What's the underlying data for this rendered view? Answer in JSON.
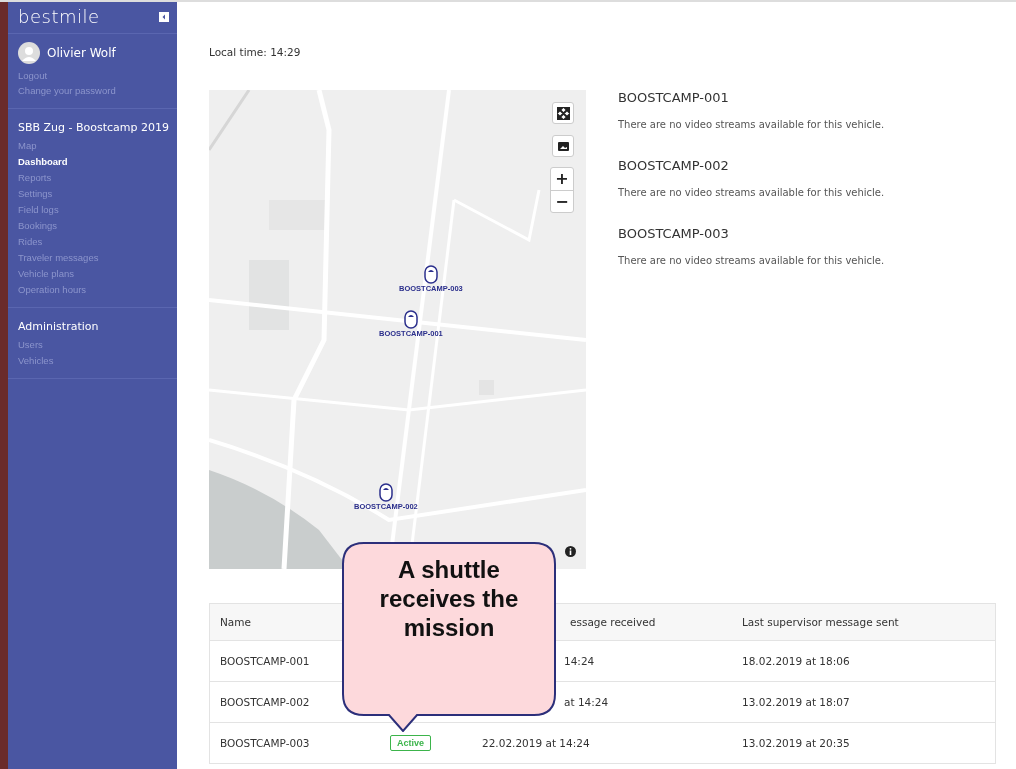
{
  "sidebar": {
    "logo": "bestmile",
    "user": {
      "name": "Olivier Wolf"
    },
    "account_links": [
      "Logout",
      "Change your password"
    ],
    "sections": [
      {
        "title": "SBB Zug - Boostcamp 2019",
        "items": [
          {
            "label": "Map",
            "selected": false
          },
          {
            "label": "Dashboard",
            "selected": true
          },
          {
            "label": "Reports",
            "selected": false
          },
          {
            "label": "Settings",
            "selected": false
          },
          {
            "label": "Field logs",
            "selected": false
          },
          {
            "label": "Bookings",
            "selected": false
          },
          {
            "label": "Rides",
            "selected": false
          },
          {
            "label": "Traveler messages",
            "selected": false
          },
          {
            "label": "Vehicle plans",
            "selected": false
          },
          {
            "label": "Operation hours",
            "selected": false
          }
        ]
      },
      {
        "title": "Administration",
        "items": [
          {
            "label": "Users",
            "selected": false
          },
          {
            "label": "Vehicles",
            "selected": false
          }
        ]
      }
    ]
  },
  "local_time": "Local time: 14:29",
  "map": {
    "kind": "picture",
    "zoom_in": "+",
    "zoom_out": "−",
    "markers": [
      {
        "label": "BOOSTCAMP-003"
      },
      {
        "label": "BOOSTCAMP-001"
      },
      {
        "label": "BOOSTCAMP-002"
      }
    ]
  },
  "streams": [
    {
      "vehicle": "BOOSTCAMP-001",
      "message": "There are no video streams available for this vehicle."
    },
    {
      "vehicle": "BOOSTCAMP-002",
      "message": "There are no video streams available for this vehicle."
    },
    {
      "vehicle": "BOOSTCAMP-003",
      "message": "There are no video streams available for this vehicle."
    }
  ],
  "table": {
    "columns": [
      "Name",
      "",
      "essage received",
      "Last supervisor message sent"
    ],
    "rows": [
      {
        "name": "BOOSTCAMP-001",
        "status": "",
        "received": "14:24",
        "sent": "18.02.2019 at 18:06"
      },
      {
        "name": "BOOSTCAMP-002",
        "status": "",
        "received": "at 14:24",
        "sent": "13.02.2019 at 18:07"
      },
      {
        "name": "BOOSTCAMP-003",
        "status": "Active",
        "received": "22.02.2019 at 14:24",
        "sent": "13.02.2019 at 20:35"
      }
    ]
  },
  "callout": {
    "text": "A shuttle receives the mission"
  }
}
